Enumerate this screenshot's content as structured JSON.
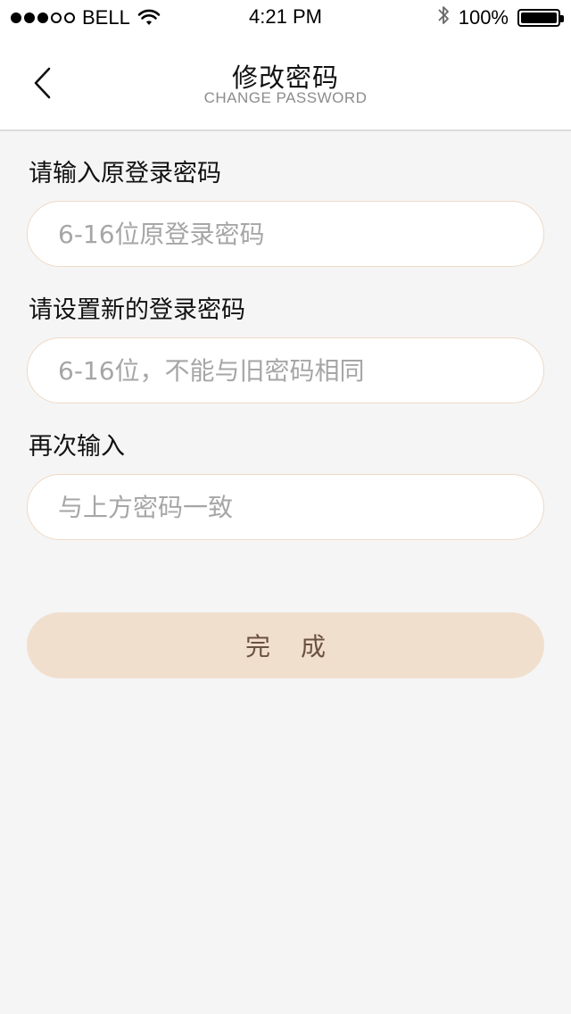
{
  "status_bar": {
    "carrier": "BELL",
    "signal_icon": "signal-dots-icon",
    "wifi_icon": "wifi-icon",
    "time": "4:21 PM",
    "bluetooth_icon": "bluetooth-icon",
    "battery_percent": "100%",
    "battery_icon": "battery-icon"
  },
  "nav": {
    "back_icon": "chevron-left-icon",
    "title": "修改密码",
    "subtitle": "CHANGE PASSWORD"
  },
  "form": {
    "old_password": {
      "label": "请输入原登录密码",
      "placeholder": "6-16位原登录密码",
      "value": ""
    },
    "new_password": {
      "label": "请设置新的登录密码",
      "placeholder": "6-16位，不能与旧密码相同",
      "value": ""
    },
    "confirm_password": {
      "label": "再次输入",
      "placeholder": "与上方密码一致",
      "value": ""
    },
    "submit_label": "完成"
  },
  "colors": {
    "background": "#f5f5f5",
    "input_border": "#efd9c5",
    "button_bg": "#f1dfce",
    "button_text": "#6b5140",
    "placeholder": "#a6a6a6"
  }
}
